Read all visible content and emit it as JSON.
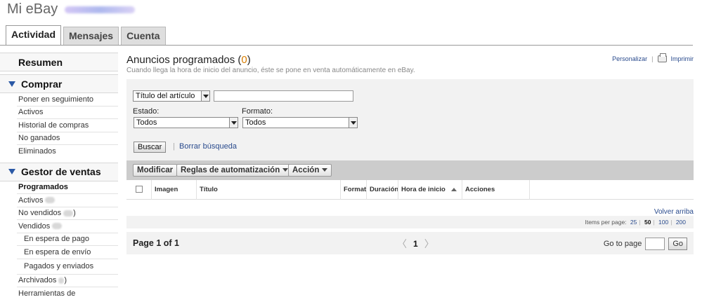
{
  "header": {
    "title": "Mi eBay"
  },
  "tabs": [
    {
      "label": "Actividad",
      "active": true
    },
    {
      "label": "Mensajes",
      "active": false
    },
    {
      "label": "Cuenta",
      "active": false
    }
  ],
  "sidebar": {
    "resumen": "Resumen",
    "comprar": {
      "title": "Comprar",
      "items": [
        "Poner en seguimiento",
        "Activos",
        "Historial de compras",
        "No ganados",
        "Eliminados"
      ]
    },
    "ventas": {
      "title": "Gestor de ventas",
      "items": [
        "Programados",
        "Activos",
        "No vendidos",
        "Vendidos",
        "En espera de pago",
        "En espera de envío",
        "Pagados y enviados",
        "Archivados",
        "Herramientas de"
      ],
      "no_vendidos_suffix": ")",
      "archivados_suffix": ")"
    }
  },
  "main": {
    "title": "Anuncios programados (",
    "count": "0",
    "title_close": ")",
    "description": "Cuando llega la hora de inicio del anuncio, éste se pone en venta automáticamente en eBay.",
    "personalizar": "Personalizar",
    "imprimir": "Imprimir"
  },
  "filters": {
    "search_field": "Título del artículo",
    "estado_label": "Estado:",
    "estado_value": "Todos",
    "formato_label": "Formato:",
    "formato_value": "Todos",
    "buscar": "Buscar",
    "borrar": "Borrar búsqueda"
  },
  "toolbar": {
    "modificar": "Modificar",
    "reglas": "Reglas de automatización",
    "accion": "Acción"
  },
  "columns": [
    "Imagen",
    "Título",
    "Format",
    "Duración",
    "Hora de inicio",
    "Acciones"
  ],
  "footer": {
    "volver": "Volver arriba",
    "items_per_page": "Items per page:",
    "per_page_options": [
      "25",
      "50",
      "100",
      "200"
    ],
    "current_per_page": "50",
    "page_info": "Page 1 of 1",
    "current_page": "1",
    "goto_label": "Go to page",
    "go": "Go"
  }
}
